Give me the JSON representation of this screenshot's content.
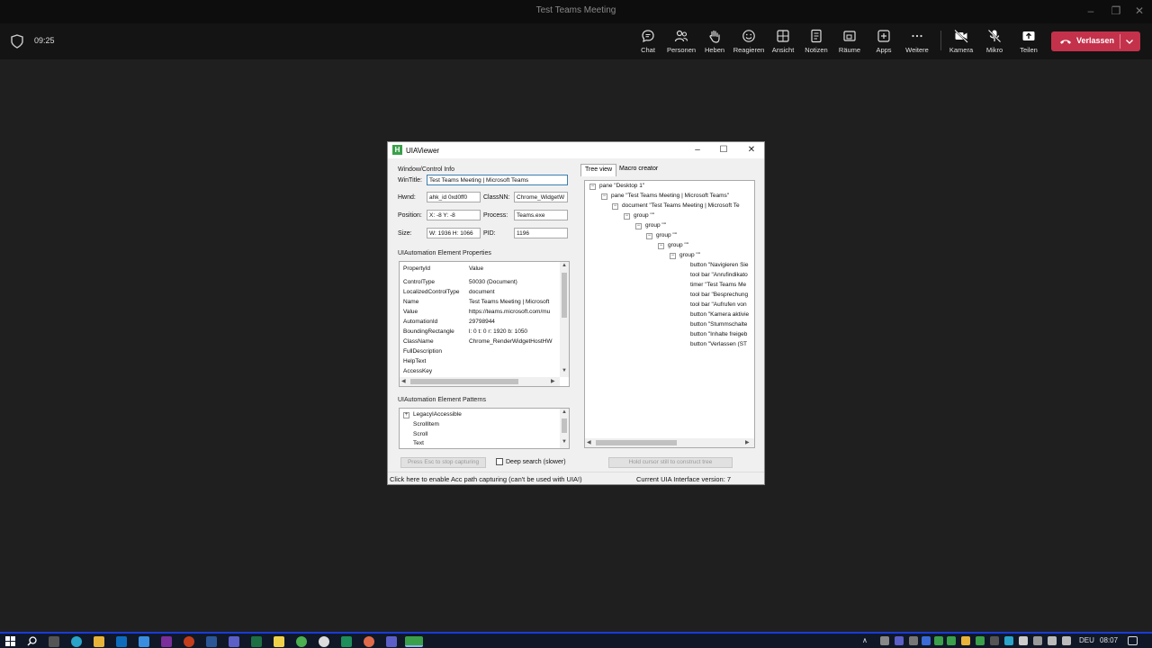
{
  "window": {
    "title": "Test Teams Meeting"
  },
  "topbar": {
    "time": "09:25",
    "tools": [
      {
        "label": "Chat",
        "icon": "chat-icon"
      },
      {
        "label": "Personen",
        "icon": "people-icon"
      },
      {
        "label": "Heben",
        "icon": "raise-hand-icon"
      },
      {
        "label": "Reagieren",
        "icon": "react-icon"
      },
      {
        "label": "Ansicht",
        "icon": "view-icon"
      },
      {
        "label": "Notizen",
        "icon": "notes-icon"
      },
      {
        "label": "Räume",
        "icon": "rooms-icon"
      },
      {
        "label": "Apps",
        "icon": "apps-icon"
      },
      {
        "label": "Weitere",
        "icon": "more-icon"
      },
      {
        "label": "Kamera",
        "icon": "camera-off-icon"
      },
      {
        "label": "Mikro",
        "icon": "mic-off-icon"
      },
      {
        "label": "Teilen",
        "icon": "share-icon"
      }
    ],
    "leave_label": "Verlassen",
    "leave_color": "#c4314b"
  },
  "dialog": {
    "title": "UIAViewer",
    "window_info": {
      "group": "Window/Control Info",
      "wintitle_label": "WinTitle:",
      "wintitle_value": "Test Teams Meeting | Microsoft Teams",
      "hwnd_label": "Hwnd:",
      "hwnd_value": "ahk_id 0xd0ff0",
      "classnn_label": "ClassNN:",
      "classnn_value": "Chrome_WidgetW",
      "position_label": "Position:",
      "position_value": "X: -8 Y: -8",
      "process_label": "Process:",
      "process_value": "Teams.exe",
      "size_label": "Size:",
      "size_value": "W: 1936 H: 1066",
      "pid_label": "PID:",
      "pid_value": "1196"
    },
    "properties": {
      "group": "UIAutomation Element Properties",
      "col_property": "PropertyId",
      "col_value": "Value",
      "rows": [
        {
          "k": "ControlType",
          "v": "50030 (Document)"
        },
        {
          "k": "LocalizedControlType",
          "v": "document"
        },
        {
          "k": "Name",
          "v": "Test Teams Meeting | Microsoft"
        },
        {
          "k": "Value",
          "v": "https://teams.microsoft.com/mu"
        },
        {
          "k": "AutomationId",
          "v": "29798944"
        },
        {
          "k": "BoundingRectangle",
          "v": "l: 0 t: 0 r: 1920 b: 1050"
        },
        {
          "k": "ClassName",
          "v": "Chrome_RenderWidgetHostHW"
        },
        {
          "k": "FullDescription",
          "v": ""
        },
        {
          "k": "HelpText",
          "v": ""
        },
        {
          "k": "AccessKey",
          "v": ""
        }
      ]
    },
    "patterns": {
      "group": "UIAutomation Element Patterns",
      "items": [
        "LegacyIAccessible",
        "ScrollItem",
        "Scroll",
        "Text"
      ]
    },
    "stop_capture_label": "Press Esc to stop capturing",
    "deep_search_label": "Deep search (slower)",
    "tabs": [
      "Tree view",
      "Macro creator"
    ],
    "tree": [
      "pane \"Desktop 1\"",
      "pane \"Test Teams Meeting | Microsoft Teams\"",
      "document \"Test Teams Meeting | Microsoft Te",
      "group \"\"",
      "group \"\"",
      "group \"\"",
      "group \"\"",
      "group \"\"",
      "button \"Navigieren Sie",
      "tool bar \"Anrufindikato",
      "timer \"Test Teams Me",
      "tool bar \"Besprechung",
      "tool bar \"Aufrufen von",
      "button \"Kamera aktivie",
      "button \"Stummschalte",
      "button \"Inhalte freigeb",
      "button \"Verlassen (ST"
    ],
    "hold_cursor_label": "Hold cursor still to construct tree",
    "status_left": "Click here to enable Acc path capturing (can't be used with UIA!)",
    "status_right": "Current UIA Interface version: 7"
  },
  "taskbar": {
    "lang": "DEU",
    "time": "08:07",
    "accent": "#1a3cd6"
  }
}
